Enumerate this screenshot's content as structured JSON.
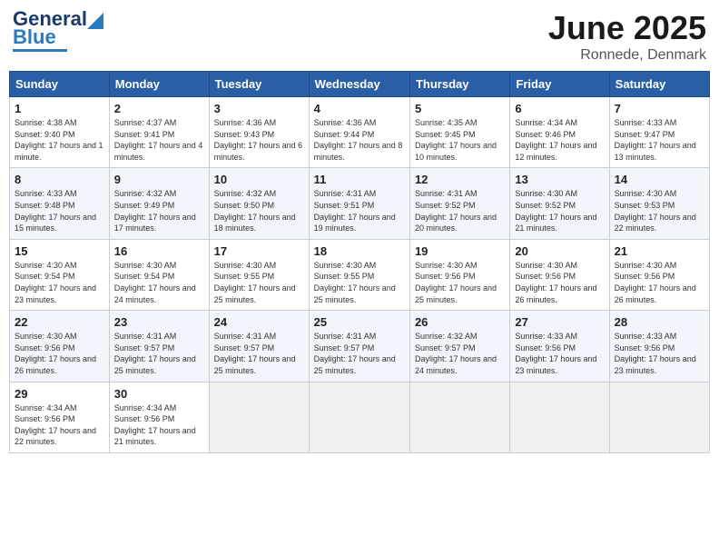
{
  "header": {
    "logo_general": "General",
    "logo_blue": "Blue",
    "title": "June 2025",
    "location": "Ronnede, Denmark"
  },
  "columns": [
    "Sunday",
    "Monday",
    "Tuesday",
    "Wednesday",
    "Thursday",
    "Friday",
    "Saturday"
  ],
  "weeks": [
    [
      {
        "day": "1",
        "sunrise": "4:38 AM",
        "sunset": "9:40 PM",
        "daylight": "17 hours and 1 minute."
      },
      {
        "day": "2",
        "sunrise": "4:37 AM",
        "sunset": "9:41 PM",
        "daylight": "17 hours and 4 minutes."
      },
      {
        "day": "3",
        "sunrise": "4:36 AM",
        "sunset": "9:43 PM",
        "daylight": "17 hours and 6 minutes."
      },
      {
        "day": "4",
        "sunrise": "4:36 AM",
        "sunset": "9:44 PM",
        "daylight": "17 hours and 8 minutes."
      },
      {
        "day": "5",
        "sunrise": "4:35 AM",
        "sunset": "9:45 PM",
        "daylight": "17 hours and 10 minutes."
      },
      {
        "day": "6",
        "sunrise": "4:34 AM",
        "sunset": "9:46 PM",
        "daylight": "17 hours and 12 minutes."
      },
      {
        "day": "7",
        "sunrise": "4:33 AM",
        "sunset": "9:47 PM",
        "daylight": "17 hours and 13 minutes."
      }
    ],
    [
      {
        "day": "8",
        "sunrise": "4:33 AM",
        "sunset": "9:48 PM",
        "daylight": "17 hours and 15 minutes."
      },
      {
        "day": "9",
        "sunrise": "4:32 AM",
        "sunset": "9:49 PM",
        "daylight": "17 hours and 17 minutes."
      },
      {
        "day": "10",
        "sunrise": "4:32 AM",
        "sunset": "9:50 PM",
        "daylight": "17 hours and 18 minutes."
      },
      {
        "day": "11",
        "sunrise": "4:31 AM",
        "sunset": "9:51 PM",
        "daylight": "17 hours and 19 minutes."
      },
      {
        "day": "12",
        "sunrise": "4:31 AM",
        "sunset": "9:52 PM",
        "daylight": "17 hours and 20 minutes."
      },
      {
        "day": "13",
        "sunrise": "4:30 AM",
        "sunset": "9:52 PM",
        "daylight": "17 hours and 21 minutes."
      },
      {
        "day": "14",
        "sunrise": "4:30 AM",
        "sunset": "9:53 PM",
        "daylight": "17 hours and 22 minutes."
      }
    ],
    [
      {
        "day": "15",
        "sunrise": "4:30 AM",
        "sunset": "9:54 PM",
        "daylight": "17 hours and 23 minutes."
      },
      {
        "day": "16",
        "sunrise": "4:30 AM",
        "sunset": "9:54 PM",
        "daylight": "17 hours and 24 minutes."
      },
      {
        "day": "17",
        "sunrise": "4:30 AM",
        "sunset": "9:55 PM",
        "daylight": "17 hours and 25 minutes."
      },
      {
        "day": "18",
        "sunrise": "4:30 AM",
        "sunset": "9:55 PM",
        "daylight": "17 hours and 25 minutes."
      },
      {
        "day": "19",
        "sunrise": "4:30 AM",
        "sunset": "9:56 PM",
        "daylight": "17 hours and 25 minutes."
      },
      {
        "day": "20",
        "sunrise": "4:30 AM",
        "sunset": "9:56 PM",
        "daylight": "17 hours and 26 minutes."
      },
      {
        "day": "21",
        "sunrise": "4:30 AM",
        "sunset": "9:56 PM",
        "daylight": "17 hours and 26 minutes."
      }
    ],
    [
      {
        "day": "22",
        "sunrise": "4:30 AM",
        "sunset": "9:56 PM",
        "daylight": "17 hours and 26 minutes."
      },
      {
        "day": "23",
        "sunrise": "4:31 AM",
        "sunset": "9:57 PM",
        "daylight": "17 hours and 25 minutes."
      },
      {
        "day": "24",
        "sunrise": "4:31 AM",
        "sunset": "9:57 PM",
        "daylight": "17 hours and 25 minutes."
      },
      {
        "day": "25",
        "sunrise": "4:31 AM",
        "sunset": "9:57 PM",
        "daylight": "17 hours and 25 minutes."
      },
      {
        "day": "26",
        "sunrise": "4:32 AM",
        "sunset": "9:57 PM",
        "daylight": "17 hours and 24 minutes."
      },
      {
        "day": "27",
        "sunrise": "4:33 AM",
        "sunset": "9:56 PM",
        "daylight": "17 hours and 23 minutes."
      },
      {
        "day": "28",
        "sunrise": "4:33 AM",
        "sunset": "9:56 PM",
        "daylight": "17 hours and 23 minutes."
      }
    ],
    [
      {
        "day": "29",
        "sunrise": "4:34 AM",
        "sunset": "9:56 PM",
        "daylight": "17 hours and 22 minutes."
      },
      {
        "day": "30",
        "sunrise": "4:34 AM",
        "sunset": "9:56 PM",
        "daylight": "17 hours and 21 minutes."
      },
      null,
      null,
      null,
      null,
      null
    ]
  ]
}
